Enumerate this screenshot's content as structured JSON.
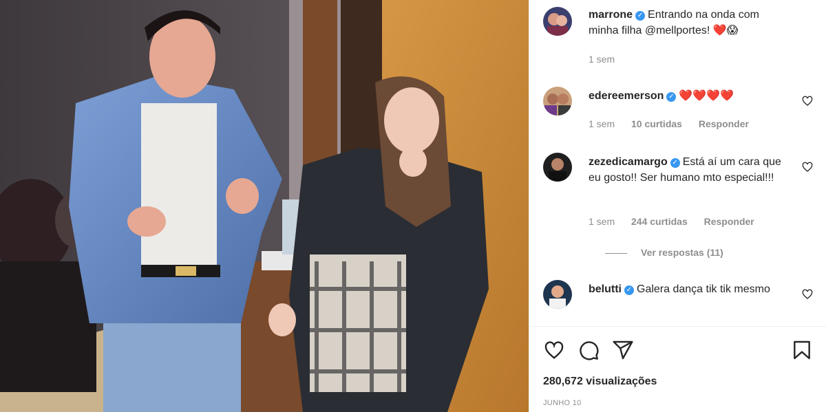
{
  "post": {
    "author": "marrone",
    "caption": "Entrando na onda com minha filha @mellportes! ❤️😱",
    "time": "1 sem"
  },
  "comments": [
    {
      "username": "edereemerson",
      "text": "❤️❤️❤️❤️",
      "time": "1 sem",
      "likes": "10 curtidas",
      "reply_label": "Responder"
    },
    {
      "username": "zezedicamargo",
      "text": "Está aí um cara que eu gosto!! Ser humano mto especial!!!",
      "time": "1 sem",
      "likes": "244 curtidas",
      "reply_label": "Responder",
      "view_replies": "Ver respostas (11)"
    },
    {
      "username": "belutti",
      "text": "Galera dança tik tik mesmo"
    }
  ],
  "footer": {
    "views": "280,672 visualizações",
    "date": "JUNHO 10"
  },
  "colors": {
    "verified": "#3897f0",
    "heart": "#ed4956",
    "muted": "#8e8e8e"
  },
  "icons": {
    "like": "heart-icon",
    "comment": "comment-icon",
    "share": "paper-plane-icon",
    "save": "bookmark-icon"
  }
}
